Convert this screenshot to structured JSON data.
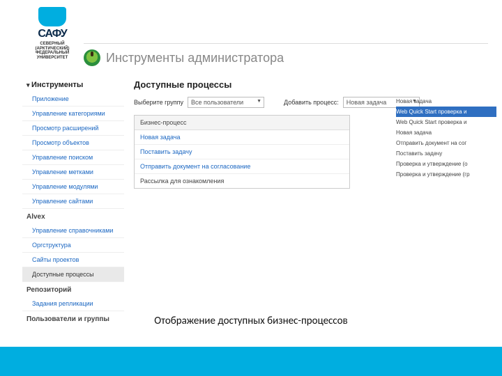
{
  "brand": {
    "name": "САФУ",
    "uni_line1": "СЕВЕРНЫЙ",
    "uni_line2": "(АРКТИЧЕСКИЙ)",
    "uni_line3": "ФЕДЕРАЛЬНЫЙ",
    "uni_line4": "УНИВЕРСИТЕТ"
  },
  "page": {
    "title": "Инструменты администратора"
  },
  "sidebar": {
    "section1": "Инструменты",
    "items1": [
      "Приложение",
      "Управление категориями",
      "Просмотр расширений",
      "Просмотр объектов",
      "Управление поиском",
      "Управление метками",
      "Управление модулями",
      "Управление сайтами"
    ],
    "section2": "Alvex",
    "items2": [
      "Управление справочниками",
      "Оргструктура",
      "Сайты проектов",
      "Доступные процессы"
    ],
    "section3": "Репозиторий",
    "items3": [
      "Задания репликации"
    ],
    "section4": "Пользователи и группы"
  },
  "main": {
    "heading": "Доступные процессы",
    "filter_label": "Выберите группу",
    "filter_value": "Все пользователи",
    "add_label": "Добавить процесс:",
    "add_value": "Новая задача",
    "table_head": "Бизнес-процесс",
    "rows": [
      "Новая задача",
      "Поставить задачу",
      "Отправить документ на согласование",
      "Рассылка для ознакомления"
    ]
  },
  "right": {
    "items": [
      "Новая задача",
      "Web Quick Start проверка и",
      "Web Quick Start проверка и",
      "Новая задача",
      "Отправить документ на сог",
      "Поставить задачу",
      "Проверка и утверждение (о",
      "Проверка и утверждение (гр"
    ]
  },
  "caption": "Отображение доступных бизнес-процессов"
}
